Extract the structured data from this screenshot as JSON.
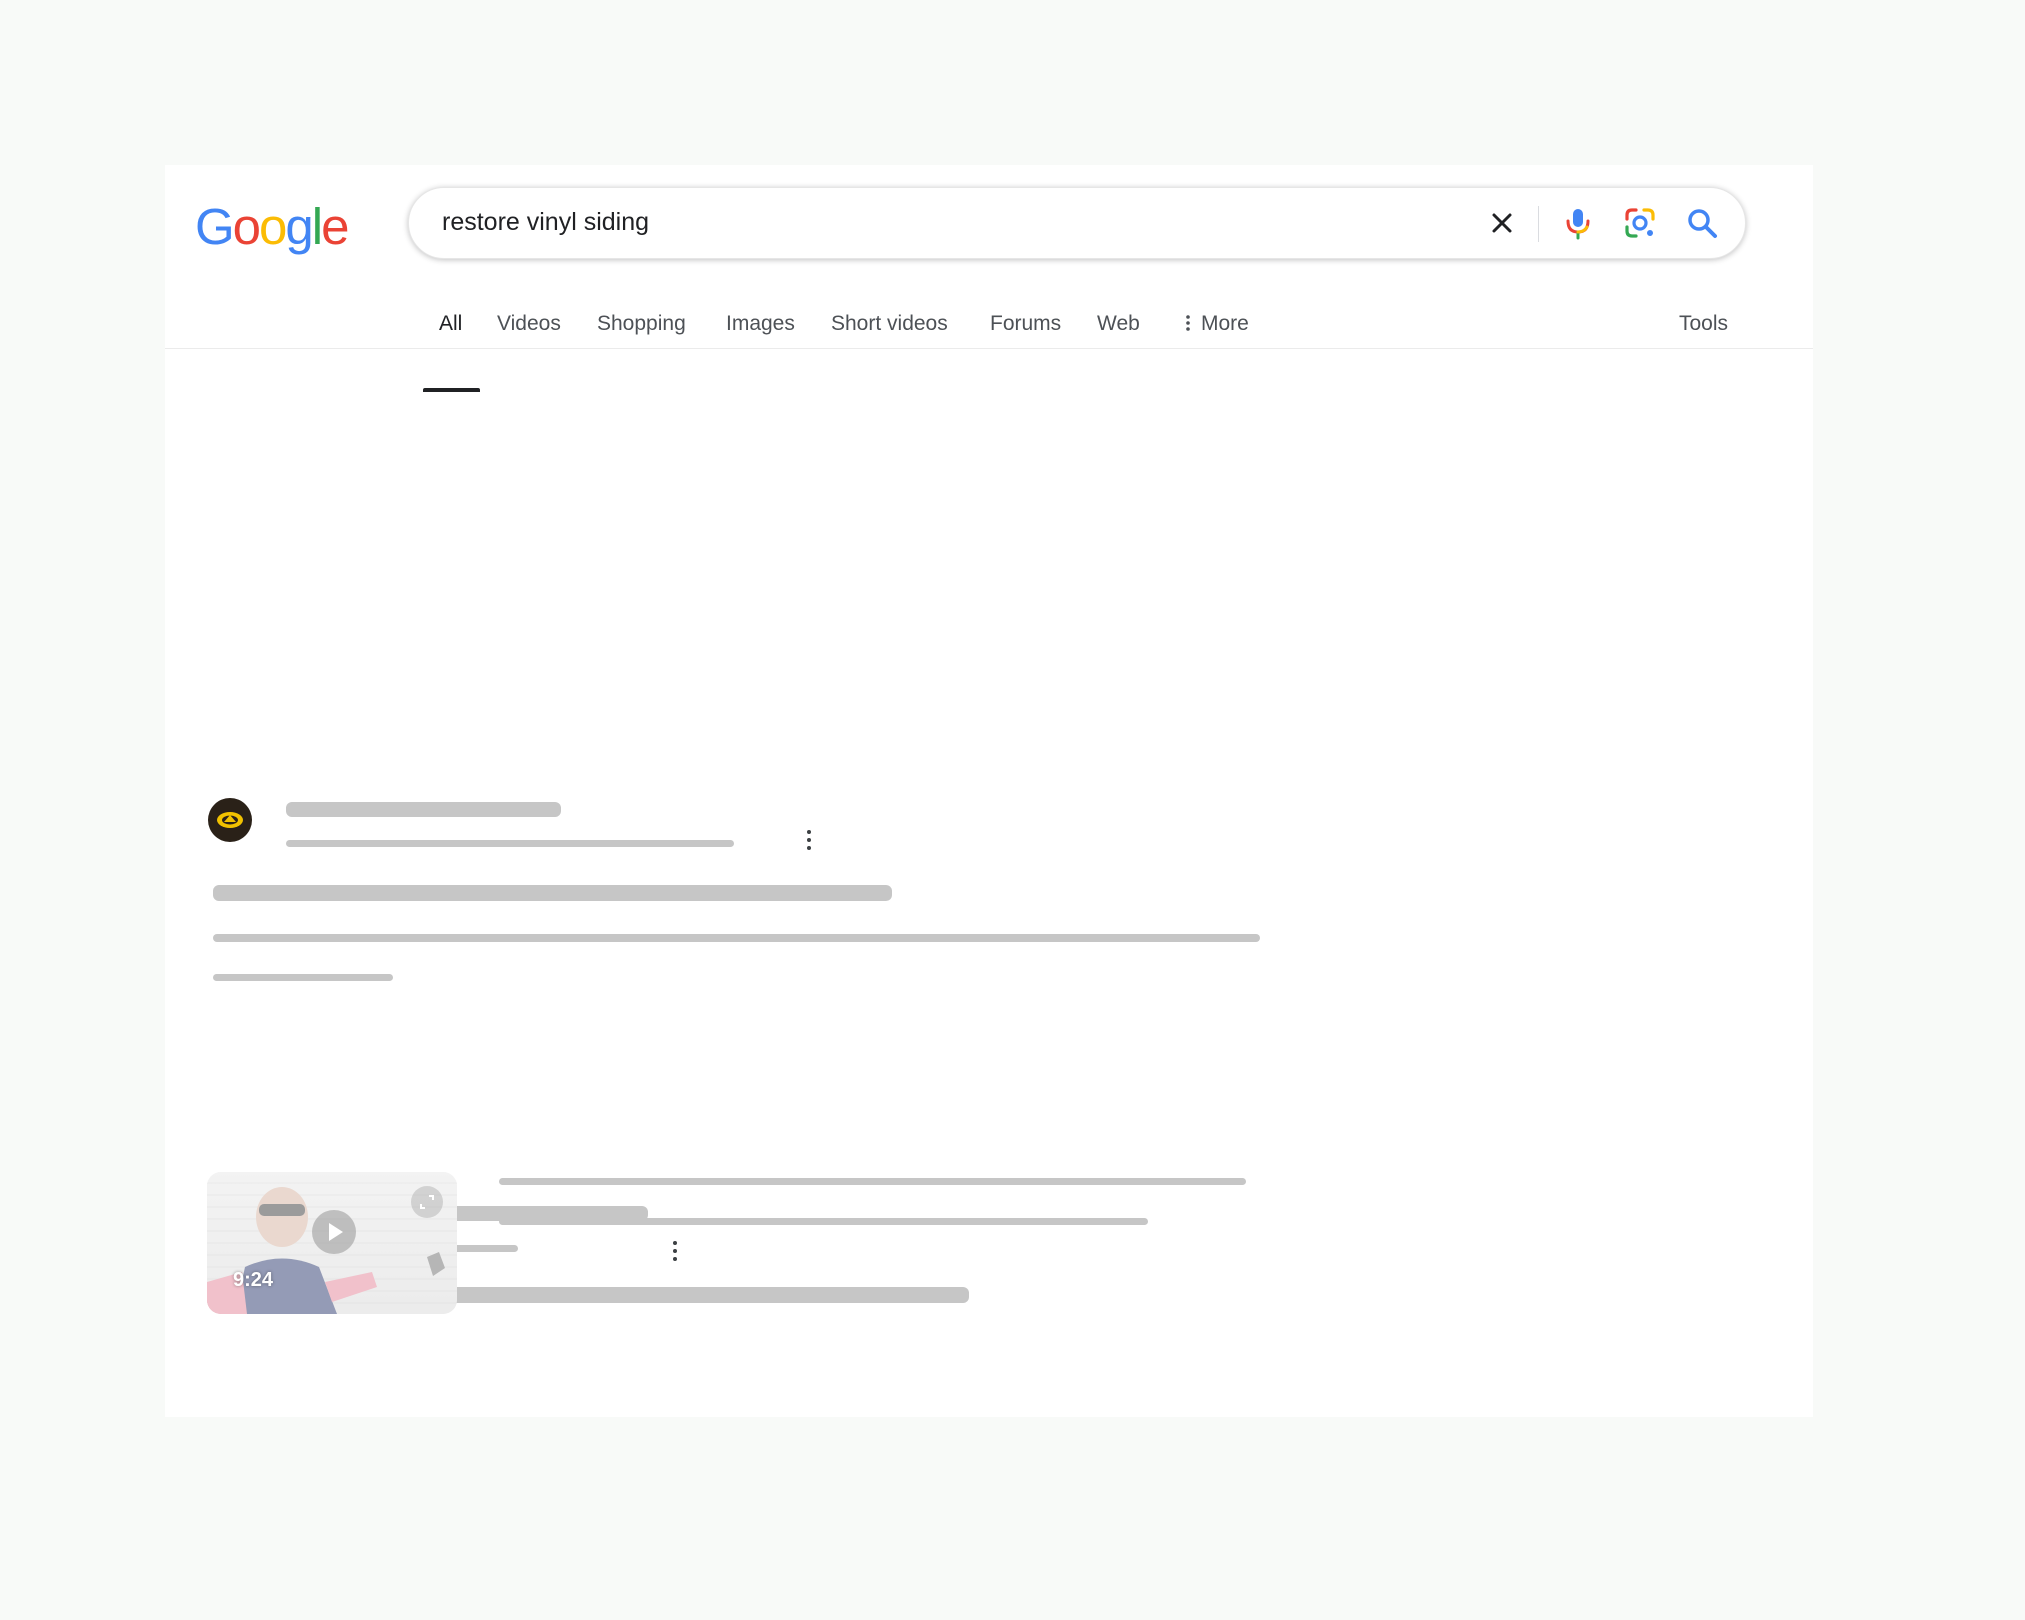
{
  "header": {
    "logo_letters": [
      "G",
      "o",
      "o",
      "g",
      "l",
      "e"
    ],
    "logo_colors": [
      "#4285F4",
      "#EA4335",
      "#FBBC05",
      "#4285F4",
      "#34A853",
      "#EA4335"
    ],
    "query": "restore vinyl siding",
    "icons": [
      "close-icon",
      "microphone-icon",
      "google-lens-icon",
      "search-icon"
    ]
  },
  "tabs": {
    "all": "All",
    "videos": "Videos",
    "shopping": "Shopping",
    "images": "Images",
    "short_videos": "Short videos",
    "forums": "Forums",
    "web": "Web",
    "more": "More",
    "tools": "Tools"
  },
  "results": {
    "result_1_favicon": "site-logo-icon",
    "result_2_favicon": "youtube-icon",
    "video": {
      "duration": "9:24",
      "play_icon": "play-icon",
      "expand_icon": "expand-icon"
    }
  },
  "colors": {
    "skeleton": "#c6c6c6",
    "youtube_red": "#FF0000",
    "active_tab": "#202124"
  }
}
